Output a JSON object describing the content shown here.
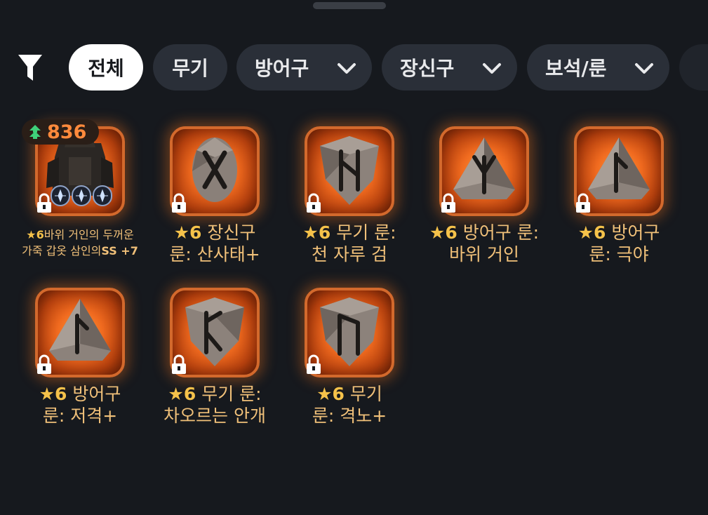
{
  "filters": {
    "chips": [
      {
        "label": "전체",
        "active": true,
        "dropdown": false
      },
      {
        "label": "무기",
        "active": false,
        "dropdown": false
      },
      {
        "label": "방어구",
        "active": false,
        "dropdown": true
      },
      {
        "label": "장신구",
        "active": false,
        "dropdown": true
      },
      {
        "label": "보석/룬",
        "active": false,
        "dropdown": true
      }
    ]
  },
  "items": [
    {
      "type": "armor",
      "power": "836",
      "star": "★",
      "grade": "6",
      "name_line1": "바위 거인의 두꺼운",
      "name_line2_a": "가죽 갑옷 삼인의",
      "name_line2_b": "SS +7",
      "locked": true
    },
    {
      "type": "rune",
      "glyph": "X",
      "shape": "oval",
      "star": "★",
      "grade": "6",
      "line1": "장신구",
      "line2": "룬: 산사태+",
      "locked": true
    },
    {
      "type": "rune",
      "glyph": "N",
      "shape": "shield",
      "star": "★",
      "grade": "6",
      "line1": "무기 룬:",
      "line2": "천 자루 검",
      "locked": true
    },
    {
      "type": "rune",
      "glyph": "Y",
      "shape": "triangle",
      "star": "★",
      "grade": "6",
      "line1": "방어구 룬:",
      "line2": "바위 거인",
      "locked": true
    },
    {
      "type": "rune",
      "glyph": "L",
      "shape": "triangle",
      "star": "★",
      "grade": "6",
      "line1": "방어구",
      "line2": "룬: 극야",
      "locked": true
    },
    {
      "type": "rune",
      "glyph": "L",
      "shape": "triangle",
      "star": "★",
      "grade": "6",
      "line1": "방어구",
      "line2": "룬: 저격+",
      "locked": true
    },
    {
      "type": "rune",
      "glyph": "E",
      "shape": "shield",
      "star": "★",
      "grade": "6",
      "line1": "무기 룬:",
      "line2": "차오르는 안개",
      "locked": true
    },
    {
      "type": "rune",
      "glyph": "U",
      "shape": "shield",
      "star": "★",
      "grade": "6",
      "line1": "무기",
      "line2": "룬: 격노+",
      "locked": true
    }
  ],
  "colors": {
    "accent": "#f06a1f",
    "caption": "#f0c079",
    "star": "#f5c24a",
    "power": "#ff8a3c"
  }
}
